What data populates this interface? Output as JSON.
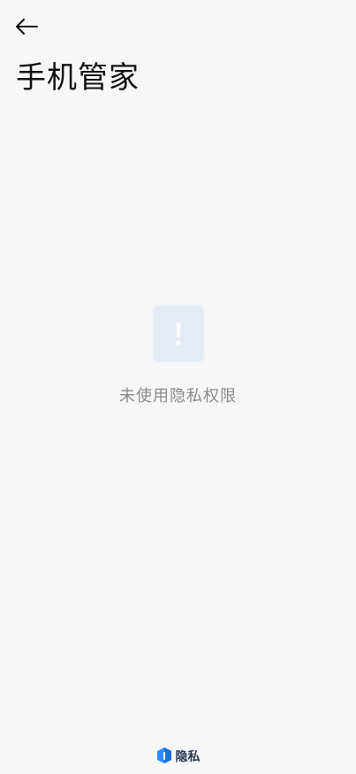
{
  "header": {
    "back_icon": "arrow-left-icon",
    "title": "手机管家"
  },
  "empty_state": {
    "icon": "exclamation-icon",
    "message": "未使用隐私权限"
  },
  "footer": {
    "logo_icon": "privacy-shield-icon",
    "label": "隐私"
  },
  "colors": {
    "background": "#f7f7f7",
    "empty_icon_bg": "#e4ebf3",
    "message_text": "#8a8a8a",
    "brand_blue": "#2d8cff"
  }
}
